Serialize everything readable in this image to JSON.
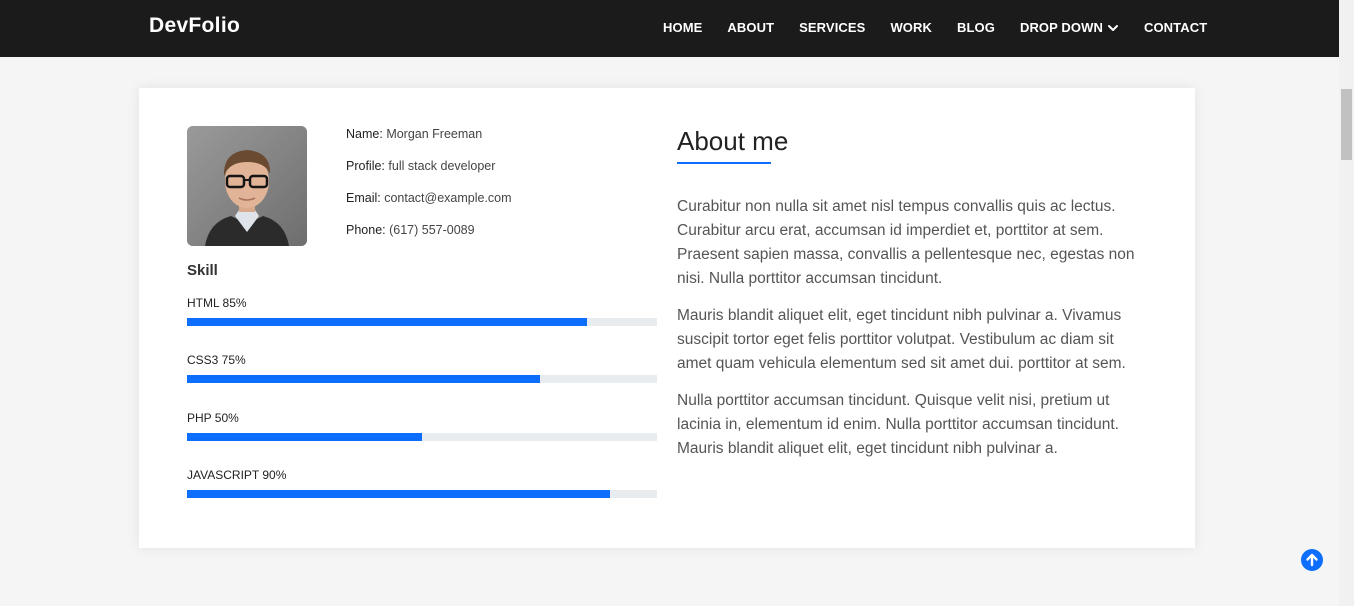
{
  "navbar": {
    "brand": "DevFolio",
    "links": [
      {
        "label": "HOME"
      },
      {
        "label": "ABOUT"
      },
      {
        "label": "SERVICES"
      },
      {
        "label": "WORK"
      },
      {
        "label": "BLOG"
      },
      {
        "label": "DROP DOWN"
      },
      {
        "label": "CONTACT"
      }
    ]
  },
  "profile": {
    "name_key": "Name:",
    "name_val": "Morgan Freeman",
    "profile_key": "Profile:",
    "profile_val": "full stack developer",
    "email_key": "Email:",
    "email_val": "contact@example.com",
    "phone_key": "Phone:",
    "phone_val": "(617) 557-0089"
  },
  "skills": {
    "title": "Skill",
    "items": [
      {
        "label": "HTML 85%",
        "percent": 85
      },
      {
        "label": "CSS3 75%",
        "percent": 75
      },
      {
        "label": "PHP 50%",
        "percent": 50
      },
      {
        "label": "JAVASCRIPT 90%",
        "percent": 90
      }
    ]
  },
  "about": {
    "title": "About me",
    "paragraphs": [
      "Curabitur non nulla sit amet nisl tempus convallis quis ac lectus. Curabitur arcu erat, accumsan id imperdiet et, porttitor at sem. Praesent sapien massa, convallis a pellentesque nec, egestas non nisi. Nulla porttitor accumsan tincidunt.",
      "Mauris blandit aliquet elit, eget tincidunt nibh pulvinar a. Vivamus suscipit tortor eget felis porttitor volutpat. Vestibulum ac diam sit amet quam vehicula elementum sed sit amet dui. porttitor at sem.",
      "Nulla porttitor accumsan tincidunt. Quisque velit nisi, pretium ut lacinia in, elementum id enim. Nulla porttitor accumsan tincidunt. Mauris blandit aliquet elit, eget tincidunt nibh pulvinar a."
    ]
  },
  "colors": {
    "accent": "#0d6efd",
    "navbar_bg": "#1b1b1b"
  },
  "icons": {
    "dropdown": "chevron-down-icon",
    "back_to_top": "arrow-up-circle-icon"
  }
}
